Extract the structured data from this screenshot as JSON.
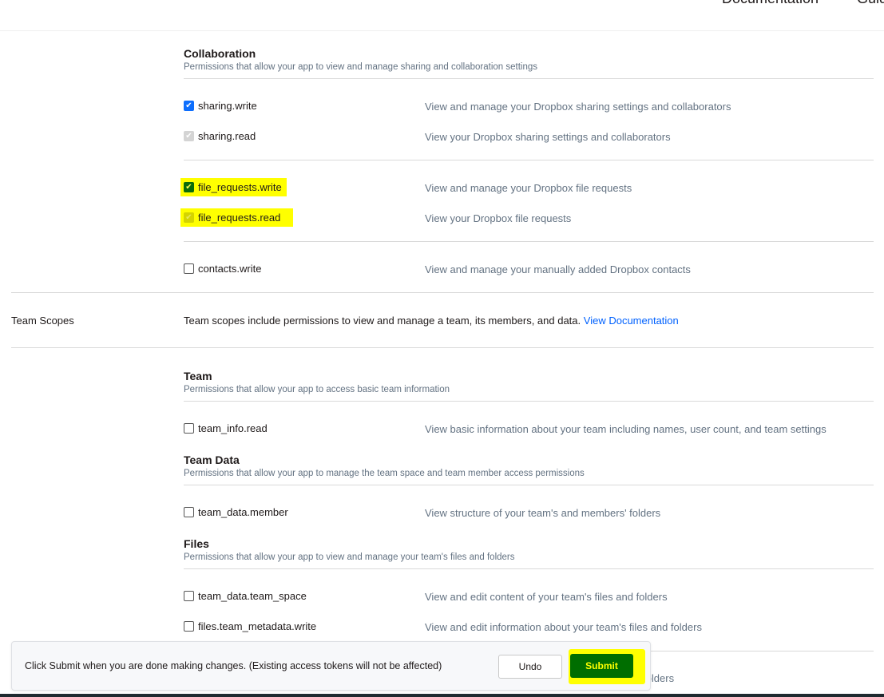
{
  "nav": {
    "documentation": "Documentation",
    "guides": "Guid"
  },
  "collaboration": {
    "title": "Collaboration",
    "desc": "Permissions that allow your app to view and manage sharing and collaboration settings",
    "perms": [
      {
        "name": "sharing.write",
        "desc": "View and manage your Dropbox sharing settings and collaborators",
        "state": "checked"
      },
      {
        "name": "sharing.read",
        "desc": "View your Dropbox sharing settings and collaborators",
        "state": "checked-disabled"
      },
      {
        "name": "file_requests.write",
        "desc": "View and manage your Dropbox file requests",
        "state": "checked"
      },
      {
        "name": "file_requests.read",
        "desc": "View your Dropbox file requests",
        "state": "checked-disabled"
      },
      {
        "name": "contacts.write",
        "desc": "View and manage your manually added Dropbox contacts",
        "state": "unchecked"
      }
    ]
  },
  "team_scopes": {
    "label": "Team Scopes",
    "desc": "Team scopes include permissions to view and manage a team, its members, and data.",
    "link": "View Documentation"
  },
  "team": {
    "title": "Team",
    "desc": "Permissions that allow your app to access basic team information",
    "perms": [
      {
        "name": "team_info.read",
        "desc": "View basic information about your team including names, user count, and team settings",
        "state": "unchecked"
      }
    ]
  },
  "team_data": {
    "title": "Team Data",
    "desc": "Permissions that allow your app to manage the team space and team member access permissions",
    "perms": [
      {
        "name": "team_data.member",
        "desc": "View structure of your team's and members' folders",
        "state": "unchecked"
      }
    ]
  },
  "files": {
    "title": "Files",
    "desc": "Permissions that allow your app to view and manage your team's files and folders",
    "perms": [
      {
        "name": "team_data.team_space",
        "desc": "View and edit content of your team's files and folders",
        "state": "unchecked"
      },
      {
        "name": "files.team_metadata.write",
        "desc": "View and edit information about your team's files and folders",
        "state": "unchecked"
      },
      {
        "name": "",
        "desc": "nd folders",
        "state": "hidden"
      }
    ]
  },
  "toast": {
    "message": "Click Submit when you are done making changes. (Existing access tokens will not be affected)",
    "undo": "Undo",
    "submit": "Submit"
  },
  "colors": {
    "link": "#0061fe",
    "highlight": "#ffff00",
    "submit_bg": "#006e00",
    "checkbox": "#0d6efd"
  }
}
